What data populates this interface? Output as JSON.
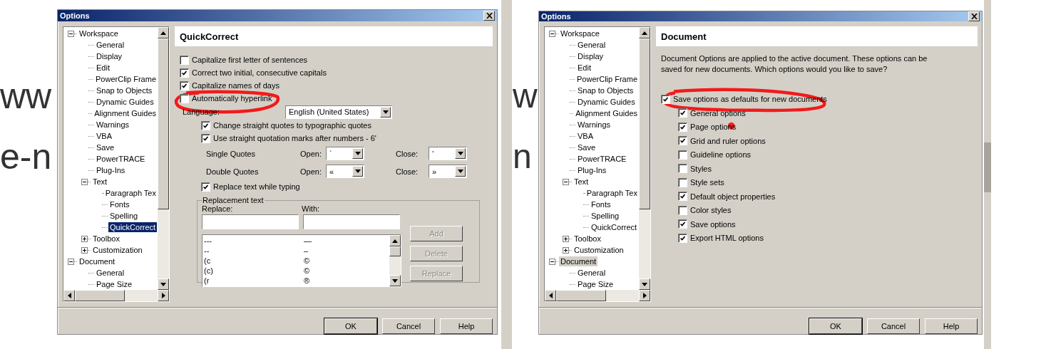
{
  "background_text": [
    {
      "text": "ww"
    },
    {
      "text": "e-n"
    },
    {
      "text": "w"
    },
    {
      "text": "n"
    }
  ],
  "dialogs": [
    {
      "title": "Options",
      "tree_focused": true,
      "tree": [
        {
          "label": "Workspace",
          "expanded": true,
          "selected": false,
          "children": [
            {
              "label": "General",
              "selected": false
            },
            {
              "label": "Display",
              "selected": false
            },
            {
              "label": "Edit",
              "selected": false
            },
            {
              "label": "PowerClip Frame",
              "selected": false
            },
            {
              "label": "Snap to Objects",
              "selected": false
            },
            {
              "label": "Dynamic Guides",
              "selected": false
            },
            {
              "label": "Alignment Guides",
              "selected": false
            },
            {
              "label": "Warnings",
              "selected": false
            },
            {
              "label": "VBA",
              "selected": false
            },
            {
              "label": "Save",
              "selected": false
            },
            {
              "label": "PowerTRACE",
              "selected": false
            },
            {
              "label": "Plug-Ins",
              "selected": false
            },
            {
              "label": "Text",
              "expanded": true,
              "selected": false,
              "children": [
                {
                  "label": "Paragraph Tex",
                  "selected": false
                },
                {
                  "label": "Fonts",
                  "selected": false
                },
                {
                  "label": "Spelling",
                  "selected": false
                },
                {
                  "label": "QuickCorrect",
                  "selected": true
                }
              ]
            },
            {
              "label": "Toolbox",
              "expanded": false,
              "selected": false
            },
            {
              "label": "Customization",
              "expanded": false,
              "selected": false
            }
          ]
        },
        {
          "label": "Document",
          "expanded": true,
          "selected": false,
          "children": [
            {
              "label": "General",
              "selected": false
            },
            {
              "label": "Page Size",
              "selected": false
            }
          ]
        }
      ],
      "panel": {
        "kind": "quickcorrect",
        "heading": "QuickCorrect",
        "options": [
          {
            "label": "Capitalize first letter of sentences",
            "checked": false
          },
          {
            "label": "Correct two initial, consecutive capitals",
            "checked": true
          },
          {
            "label": "Capitalize names of days",
            "checked": true
          },
          {
            "label": "Automatically hyperlink",
            "checked": false
          }
        ],
        "language": {
          "label": "Language:",
          "value": "English (United States)"
        },
        "quote_options": [
          {
            "label": "Change straight quotes to typographic quotes",
            "checked": true
          },
          {
            "label": "Use straight quotation marks after numbers - 6'",
            "checked": true
          }
        ],
        "quote_rows": [
          {
            "label": "Single Quotes",
            "open_label": "Open:",
            "open_value": "`",
            "close_label": "Close:",
            "close_value": "’"
          },
          {
            "label": "Double Quotes",
            "open_label": "Open:",
            "open_value": "«",
            "close_label": "Close:",
            "close_value": "»"
          }
        ],
        "replace_option": {
          "label": "Replace text while typing",
          "checked": true
        },
        "replacement": {
          "title": "Replacement text",
          "replace_label": "Replace:",
          "with_label": "With:",
          "entries": [
            {
              "replace": "---",
              "with": "—"
            },
            {
              "replace": "--",
              "with": "–"
            },
            {
              "replace": "(c",
              "with": "©"
            },
            {
              "replace": "(c)",
              "with": "©"
            },
            {
              "replace": "(r",
              "with": "®"
            }
          ],
          "buttons": [
            {
              "label": "Add",
              "disabled": true
            },
            {
              "label": "Delete",
              "disabled": true
            },
            {
              "label": "Replace",
              "disabled": true
            }
          ]
        }
      },
      "buttons": [
        "OK",
        "Cancel",
        "Help"
      ]
    },
    {
      "title": "Options",
      "tree_focused": false,
      "tree": [
        {
          "label": "Workspace",
          "expanded": true,
          "selected": false,
          "children": [
            {
              "label": "General",
              "selected": false
            },
            {
              "label": "Display",
              "selected": false
            },
            {
              "label": "Edit",
              "selected": false
            },
            {
              "label": "PowerClip Frame",
              "selected": false
            },
            {
              "label": "Snap to Objects",
              "selected": false
            },
            {
              "label": "Dynamic Guides",
              "selected": false
            },
            {
              "label": "Alignment Guides",
              "selected": false
            },
            {
              "label": "Warnings",
              "selected": false
            },
            {
              "label": "VBA",
              "selected": false
            },
            {
              "label": "Save",
              "selected": false
            },
            {
              "label": "PowerTRACE",
              "selected": false
            },
            {
              "label": "Plug-Ins",
              "selected": false
            },
            {
              "label": "Text",
              "expanded": true,
              "selected": false,
              "children": [
                {
                  "label": "Paragraph Tex",
                  "selected": false
                },
                {
                  "label": "Fonts",
                  "selected": false
                },
                {
                  "label": "Spelling",
                  "selected": false
                },
                {
                  "label": "QuickCorrect",
                  "selected": false
                }
              ]
            },
            {
              "label": "Toolbox",
              "expanded": false,
              "selected": false
            },
            {
              "label": "Customization",
              "expanded": false,
              "selected": false
            }
          ]
        },
        {
          "label": "Document",
          "expanded": true,
          "selected": true,
          "children": [
            {
              "label": "General",
              "selected": false
            },
            {
              "label": "Page Size",
              "selected": false
            }
          ]
        }
      ],
      "panel": {
        "kind": "document",
        "heading": "Document",
        "description": "Document Options are applied to the active document. These options can be saved for new documents. Which options would you like to save?",
        "main_option": {
          "label": "Save options as defaults for new documents",
          "checked": true
        },
        "options": [
          {
            "label": "General options",
            "checked": true
          },
          {
            "label": "Page options",
            "checked": true
          },
          {
            "label": "Grid and ruler options",
            "checked": true
          },
          {
            "label": "Guideline options",
            "checked": false
          },
          {
            "label": "Styles",
            "checked": false
          },
          {
            "label": "Style sets",
            "checked": false
          },
          {
            "label": "Default object properties",
            "checked": true
          },
          {
            "label": "Color styles",
            "checked": false
          },
          {
            "label": "Save options",
            "checked": true
          },
          {
            "label": "Export HTML options",
            "checked": true
          }
        ]
      },
      "buttons": [
        "OK",
        "Cancel",
        "Help"
      ]
    }
  ]
}
